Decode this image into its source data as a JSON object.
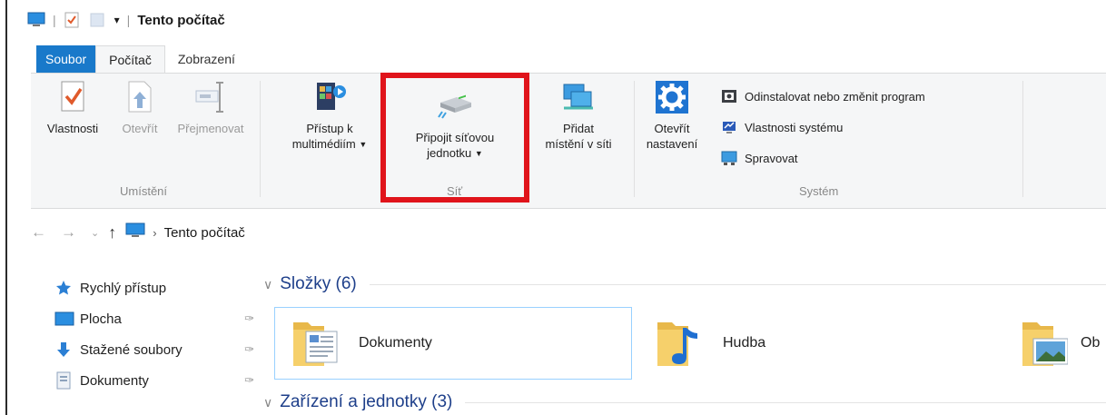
{
  "window": {
    "title": "Tento počítač"
  },
  "tabs": [
    "Soubor",
    "Počítač",
    "Zobrazení"
  ],
  "ribbon": {
    "groups": {
      "location": "Umístění",
      "network": "Síť",
      "system": "Systém"
    },
    "buttons": {
      "properties": "Vlastnosti",
      "open": "Otevřít",
      "rename": "Přejmenovat",
      "media_access_l1": "Přístup k",
      "media_access_l2": "multimédiím",
      "map_drive_l1": "Připojit síťovou",
      "map_drive_l2": "jednotku",
      "add_location_l1": "Přidat",
      "add_location_l2": "místění v síti",
      "open_settings_l1": "Otevřít",
      "open_settings_l2": "nastavení"
    },
    "system_items": [
      "Odinstalovat nebo změnit program",
      "Vlastnosti systému",
      "Spravovat"
    ]
  },
  "address": {
    "path": "Tento počítač"
  },
  "nav": {
    "items": [
      "Rychlý přístup",
      "Plocha",
      "Stažené soubory",
      "Dokumenty"
    ]
  },
  "content": {
    "folders_header": "Složky (6)",
    "devices_header": "Zařízení a jednotky (3)",
    "folders": [
      "Dokumenty",
      "Hudba",
      "Ob"
    ]
  },
  "colors": {
    "accent": "#1979ca",
    "highlight": "#e0141b",
    "header_blue": "#1e3f8a"
  }
}
